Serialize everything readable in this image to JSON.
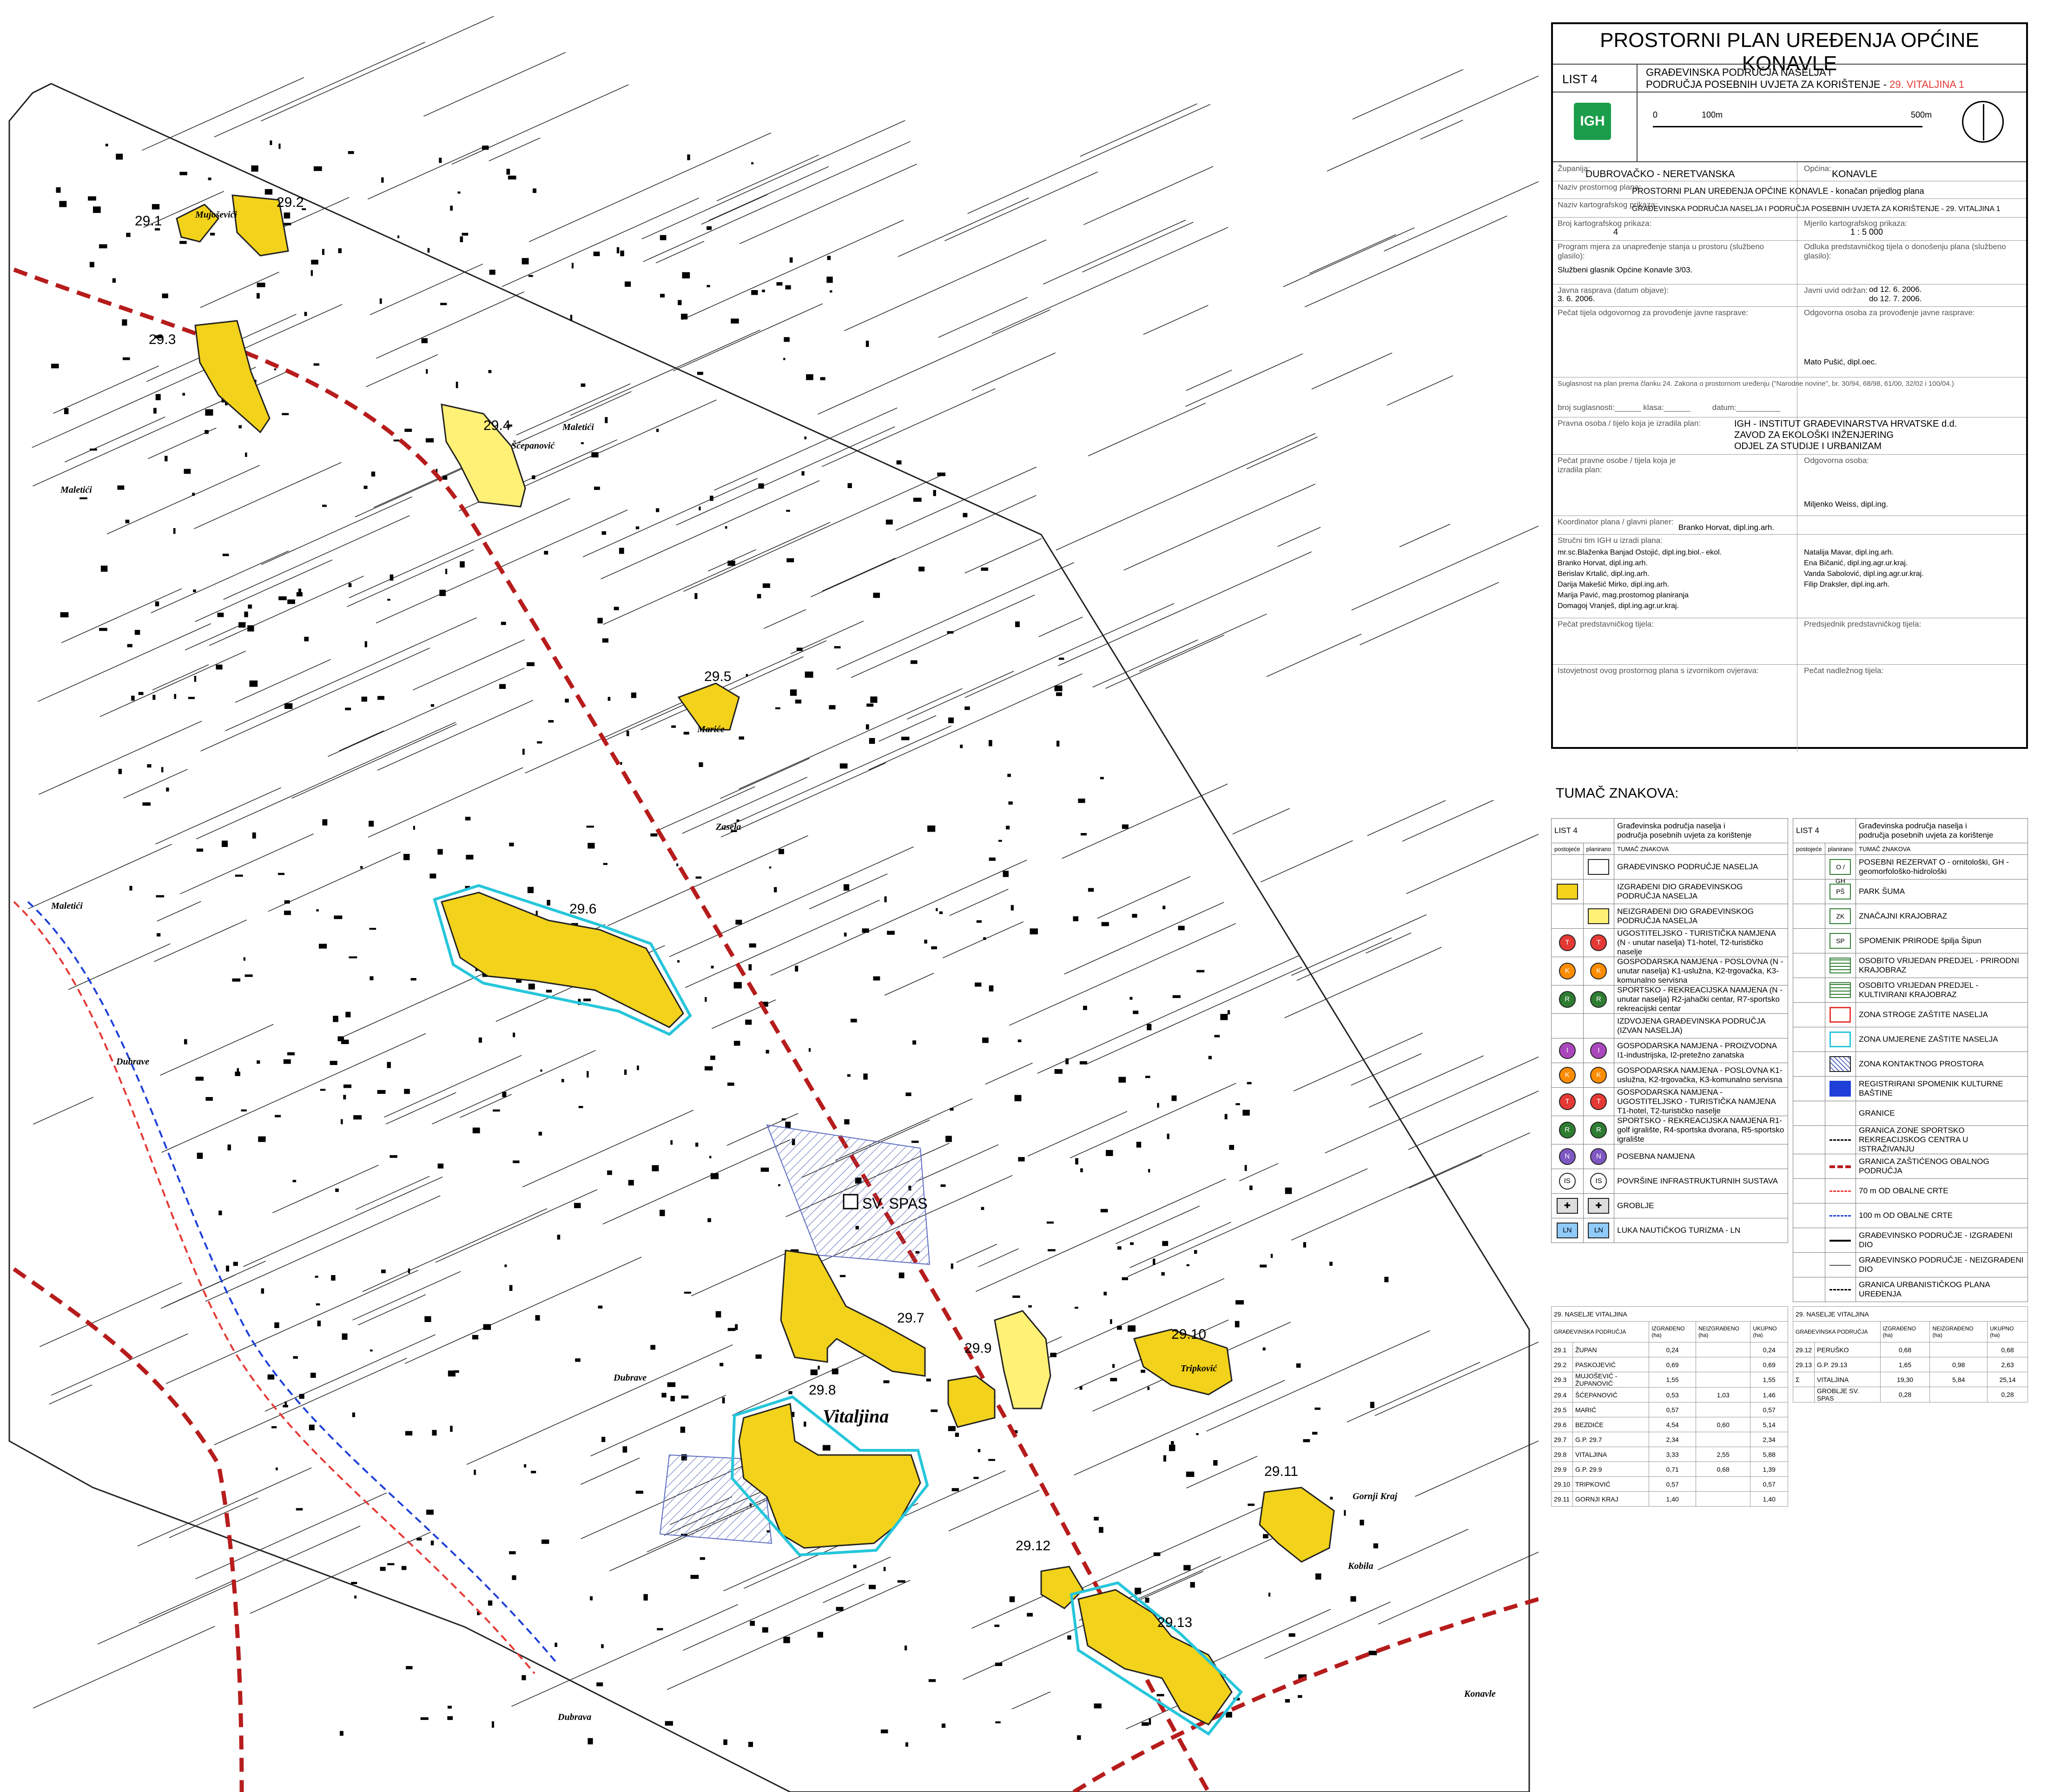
{
  "title_block": {
    "main_title": "PROSTORNI PLAN UREĐENJA OPĆINE KONAVLE",
    "sheet": "LIST 4",
    "sheet_title_1": "GRAĐEVINSKA PODRUČJA NASELJA I",
    "sheet_title_2": "PODRUČJA POSEBNIH UVJETA ZA KORIŠTENJE - ",
    "sheet_title_red": "29. VITALJINA 1",
    "scale_0": "0",
    "scale_100": "100m",
    "scale_500": "500m",
    "logo_text": "IGH",
    "zupanija_label": "Županija:",
    "zupanija": "DUBROVAČKO - NERETVANSKA",
    "opcina_label": "Općina:",
    "opcina": "KONAVLE",
    "naziv_plana_label": "Naziv prostornog plana:",
    "naziv_plana": "PROSTORNI PLAN UREĐENJA OPĆINE KONAVLE - konačan prijedlog plana",
    "naziv_kart_label": "Naziv kartografskog prikaza:",
    "naziv_kart": "GRAĐEVINSKA PODRUČJA NASELJA I PODRUČJA POSEBNIH UVJETA ZA KORIŠTENJE - 29. VITALJINA 1",
    "broj_kart_label": "Broj kartografskog prikaza:",
    "broj_kart": "4",
    "mjerilo_label": "Mjerilo kartografskog prikaza:",
    "mjerilo": "1 : 5 000",
    "program_label": "Program mjera za unapređenje stanja u prostoru (službeno glasilo):",
    "program": "Službeni glasnik Općine Konavle 3/03.",
    "odluka_label": "Odluka predstavničkog tijela o donošenju plana (službeno glasilo):",
    "javna_label": "Javna rasprava (datum objave):",
    "javna": "3. 6. 2006.",
    "uvid_label": "Javni uvid održan:",
    "uvid_od": "od 12. 6. 2006.",
    "uvid_do": "do 12. 7. 2006.",
    "pecat_tijela_label": "Pečat tijela odgovornog za provođenje javne rasprave:",
    "odgovorna_label": "Odgovorna osoba za provođenje javne rasprave:",
    "odgovorna": "Mato Pušić, dipl.oec.",
    "suglasnost": "Suglasnost na plan prema članku 24. Zakona o prostornom uređenju (\"Narodne novine\", br. 30/94, 68/98, 61/00, 32/02 i 100/04.)",
    "broj_suglasnosti": "broj suglasnosti:______ klasa:______          datum:__________",
    "pravna_label": "Pravna osoba / tijelo koja je izradila plan:",
    "pravna_1": "IGH - INSTITUT GRAĐEVINARSTVA HRVATSKE d.d.",
    "pravna_2": "ZAVOD ZA EKOLOŠKI INŽENJERING",
    "pravna_3": "ODJEL ZA STUDIJE I URBANIZAM",
    "pecat_pravne_label": "Pečat pravne osobe / tijela koja je izradila plan:",
    "odgovorna2_label": "Odgovorna osoba:",
    "odgovorna2": "Miljenko Weiss, dipl.ing.",
    "koordinator_label": "Koordinator plana / glavni planer:",
    "koordinator": "Branko Horvat, dipl.ing.arh.",
    "strucni_label": "Stručni tim IGH u izradi plana:",
    "tim_left": [
      "mr.sc.Blaženka Banjad Ostojić, dipl.ing.biol.- ekol.",
      "Branko Horvat, dipl.ing.arh.",
      "Berislav Krtalić, dipl.ing.arh.",
      "Darija Makešić Mirko, dipl.ing.arh.",
      "Marija Pavić, mag.prostornog planiranja",
      "Domagoj Vranješ, dipl.ing.agr.ur.kraj."
    ],
    "tim_right": [
      "Natalija Mavar, dipl.ing.arh.",
      "Ena Bičanić, dipl.ing.agr.ur.kraj.",
      "Vanda Sabolović, dipl.ing.agr.ur.kraj.",
      "Filip Draksler, dipl.ing.arh."
    ],
    "pecat_pred_label": "Pečat predstavničkog tijela:",
    "predsjednik_label": "Predsjednik predstavničkog tijela:",
    "istovjetnost_label": "Istovjetnost ovog prostornog plana s izvornikom ovjerava:",
    "pecat_nadl_label": "Pečat nadležnog tijela:"
  },
  "legend": {
    "heading": "TUMAČ ZNAKOVA:",
    "col_head_list": "LIST 4",
    "col_head_title_1": "Građevinska područja naselja i",
    "col_head_title_2": "područja posebnih uvjeta za korištenje",
    "postojece": "postojeće",
    "planirano": "planirano",
    "tumac": "TUMAČ ZNAKOVA",
    "left_items": [
      {
        "text": "GRAĐEVINSKO PODRUČJE NASELJA",
        "sym": "outline"
      },
      {
        "text": "IZGRAĐENI DIO GRAĐEVINSKOG PODRUČJA NASELJA",
        "sym": "yellow-dark",
        "color": "#f2d21a"
      },
      {
        "text": "NEIZGRAĐENI DIO GRAĐEVINSKOG PODRUČJA NASELJA",
        "sym": "yellow-light",
        "color": "#fff176"
      },
      {
        "text": "UGOSTITELJSKO - TURISTIČKA NAMJENA (N - unutar naselja) T1-hotel, T2-turističko naselje",
        "sym": "circle-T",
        "color": "#e53935"
      },
      {
        "text": "GOSPODARSKA NAMJENA - POSLOVNA (N - unutar naselja) K1-uslužna, K2-trgovačka, K3-komunalno servisna",
        "sym": "circle-K",
        "color": "#fb8c00"
      },
      {
        "text": "SPORTSKO - REKREACIJSKA NAMJENA (N - unutar naselja) R2-jahački centar, R7-sportsko rekreacijski centar",
        "sym": "circle-R",
        "color": "#2e7d32"
      },
      {
        "text": "IZDVOJENA GRAĐEVINSKA PODRUČJA (IZVAN NASELJA)",
        "sym": "none"
      },
      {
        "text": "GOSPODARSKA NAMJENA - PROIZVODNA I1-industrijska, I2-pretežno zanatska",
        "sym": "circle-I",
        "color": "#ab47bc"
      },
      {
        "text": "GOSPODARSKA NAMJENA - POSLOVNA K1-uslužna, K2-trgovačka, K3-komunalno servisna",
        "sym": "circle-K",
        "color": "#fb8c00"
      },
      {
        "text": "GOSPODARSKA NAMJENA - UGOSTITELJSKO - TURISTIČKA NAMJENA T1-hotel, T2-turističko naselje",
        "sym": "circle-T",
        "color": "#e53935"
      },
      {
        "text": "SPORTSKO - REKREACIJSKA NAMJENA R1-golf igralište, R4-sportska dvorana, R5-sportsko igralište",
        "sym": "circle-R",
        "color": "#2e7d32"
      },
      {
        "text": "POSEBNA NAMJENA",
        "sym": "circle-N",
        "color": "#7e57c2"
      },
      {
        "text": "POVRŠINE INFRASTRUKTURNIH SUSTAVA",
        "sym": "circle-IS",
        "color": "#ffffff"
      },
      {
        "text": "GROBLJE",
        "sym": "cross",
        "color": "#dddddd"
      },
      {
        "text": "LUKA NAUTIČKOG TURIZMA - LN",
        "sym": "LN",
        "color": "#90caf9"
      }
    ],
    "right_items": [
      {
        "text": "POSEBNI REZERVAT O - ornitološki, GH - geomorfološko-hidrološki",
        "sym": "O / GH"
      },
      {
        "text": "PARK ŠUMA",
        "sym": "PŠ"
      },
      {
        "text": "ZNAČAJNI KRAJOBRAZ",
        "sym": "ZK"
      },
      {
        "text": "SPOMENIK PRIRODE špilja Šipun",
        "sym": "SP"
      },
      {
        "text": "OSOBITO VRIJEDAN PREDJEL - PRIRODNI KRAJOBRAZ",
        "sym": "green-hatch"
      },
      {
        "text": "OSOBITO VRIJEDAN PREDJEL - KULTIVIRANI KRAJOBRAZ",
        "sym": "green-hatch"
      },
      {
        "text": "ZONA STROGE ZAŠTITE NASELJA",
        "sym": "red-box"
      },
      {
        "text": "ZONA UMJERENE ZAŠTITE NASELJA",
        "sym": "cyan-box"
      },
      {
        "text": "ZONA KONTAKTNOG PROSTORA",
        "sym": "blue-hatch"
      },
      {
        "text": "REGISTRIRANI SPOMENIK KULTURNE BAŠTINE",
        "sym": "heritage"
      },
      {
        "text": "GRANICE",
        "sym": "none"
      },
      {
        "text": "GRANICA ZONE SPORTSKO REKREACIJSKOG CENTRA U ISTRAŽIVANJU",
        "sym": "dash-black"
      },
      {
        "text": "GRANICA ZAŠTIĆENOG OBALNOG PODRUČJA",
        "sym": "dash-darkred"
      },
      {
        "text": "70 m OD OBALNE CRTE",
        "sym": "dash-red"
      },
      {
        "text": "100 m OD OBALNE CRTE",
        "sym": "dash-blue"
      },
      {
        "text": "GRAĐEVINSKO PODRUČJE - IZGRAĐENI DIO",
        "sym": "line-thick"
      },
      {
        "text": "GRAĐEVINSKO PODRUČJE - NEIZGRAĐENI DIO",
        "sym": "line-thin"
      },
      {
        "text": "GRANICA URBANISTIČKOG PLANA UREĐENJA",
        "sym": "dashdot"
      }
    ]
  },
  "stats": {
    "left_title": "29. NASELJE VITALJINA",
    "right_title": "29. NASELJE VITALJINA",
    "headers": [
      "GRAĐEVINSKA PODRUČJA",
      "IZGRAĐENO (ha)",
      "NEIZGRAĐENO (ha)",
      "UKUPNO (ha)"
    ],
    "left_rows": [
      [
        "29.1",
        "ŽUPAN",
        "0,24",
        "",
        "0,24"
      ],
      [
        "29.2",
        "PASKOJEVIĆ",
        "0,69",
        "",
        "0,69"
      ],
      [
        "29.3",
        "MUJOŠEVIĆ - ŽUPANOVIĆ",
        "1,55",
        "",
        "1,55"
      ],
      [
        "29.4",
        "ŠĆEPANOVIĆ",
        "0,53",
        "1,03",
        "1,46"
      ],
      [
        "29.5",
        "MARIĆ",
        "0,57",
        "",
        "0,57"
      ],
      [
        "29.6",
        "BEZDIĆE",
        "4,54",
        "0,60",
        "5,14"
      ],
      [
        "29.7",
        "G.P. 29.7",
        "2,34",
        "",
        "2,34"
      ],
      [
        "29.8",
        "VITALJINA",
        "3,33",
        "2,55",
        "5,88"
      ],
      [
        "29.9",
        "G.P. 29.9",
        "0,71",
        "0,68",
        "1,39"
      ],
      [
        "29.10",
        "TRIPKOVIĆ",
        "0,57",
        "",
        "0,57"
      ],
      [
        "29.11",
        "GORNJI KRAJ",
        "1,40",
        "",
        "1,40"
      ]
    ],
    "right_rows": [
      [
        "29.12",
        "PERUŠKO",
        "0,68",
        "",
        "0,68"
      ],
      [
        "29.13",
        "G.P. 29.13",
        "1,65",
        "0,98",
        "2,63"
      ],
      [
        "Σ",
        "VITALJINA",
        "19,30",
        "5,84",
        "25,14"
      ],
      [
        "",
        "GROBLJE SV. SPAS",
        "0,28",
        "",
        "0,28"
      ]
    ]
  },
  "map": {
    "area_labels": [
      "29.1",
      "29.2",
      "29.3",
      "29.4",
      "29.5",
      "29.6",
      "29.7",
      "29.8",
      "29.9",
      "29.10",
      "29.11",
      "29.12",
      "29.13"
    ],
    "place_names": [
      "Mujoševići",
      "Šćepanović",
      "Maletići",
      "Maletići",
      "Mariće",
      "Zasela",
      "Maletići",
      "Dubrave",
      "Dubrave",
      "Vitaljina",
      "Tripković",
      "Gornji Kraj",
      "Dubrava",
      "Kobila",
      "Konavle",
      "Sv. Spas"
    ],
    "church_label": "SV. SPAS",
    "colors": {
      "built": "#f2d21a",
      "unbuilt": "#fff176",
      "coast": "#b71c1c",
      "moderate_zone": "#26c6da"
    }
  }
}
